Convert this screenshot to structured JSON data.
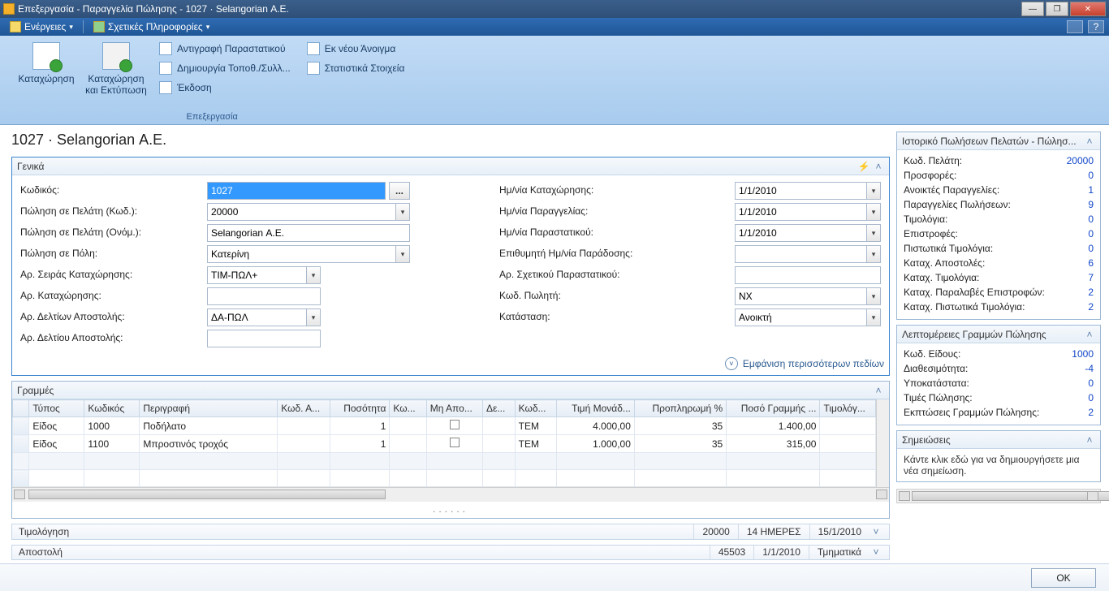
{
  "window": {
    "title": "Επεξεργασία - Παραγγελία Πώλησης - 1027 · Selangorian Α.Ε."
  },
  "menu": {
    "actions": "Ενέργειες",
    "related": "Σχετικές Πληροφορίες"
  },
  "ribbon": {
    "big": [
      {
        "label": "Καταχώρηση"
      },
      {
        "label": "Καταχώρηση και Εκτύπωση"
      }
    ],
    "col1": [
      "Αντιγραφή Παραστατικού",
      "Δημιουργία Τοποθ./Συλλ...",
      "Έκδοση"
    ],
    "col2": [
      "Εκ νέου Άνοιγμα",
      "Στατιστικά Στοιχεία"
    ],
    "group_caption": "Επεξεργασία"
  },
  "page_title": "1027 · Selangorian Α.Ε.",
  "general": {
    "caption": "Γενικά",
    "labels": {
      "code": "Κωδικός:",
      "cust_code": "Πώληση σε Πελάτη (Κωδ.):",
      "cust_name": "Πώληση σε Πελάτη (Ονόμ.):",
      "city": "Πώληση σε Πόλη:",
      "posting_series": "Αρ. Σειράς Καταχώρησης:",
      "posting_no": "Αρ. Καταχώρησης:",
      "ship_series": "Αρ. Δελτίων Αποστολής:",
      "ship_no": "Αρ. Δελτίου Αποστολής:",
      "posting_date": "Ημ/νία Καταχώρησης:",
      "order_date": "Ημ/νία Παραγγελίας:",
      "doc_date": "Ημ/νία Παραστατικού:",
      "req_date": "Επιθυμητή Ημ/νία Παράδοσης:",
      "related_doc": "Αρ. Σχετικού Παραστατικού:",
      "salesperson": "Κωδ. Πωλητή:",
      "status": "Κατάσταση:"
    },
    "values": {
      "code": "1027",
      "cust_code": "20000",
      "cust_name": "Selangorian Α.Ε.",
      "city": "Κατερίνη",
      "posting_series": "ΤΙΜ-ΠΩΛ+",
      "posting_no": "",
      "ship_series": "ΔΑ-ΠΩΛ",
      "ship_no": "",
      "posting_date": "1/1/2010",
      "order_date": "1/1/2010",
      "doc_date": "1/1/2010",
      "req_date": "",
      "related_doc": "",
      "salesperson": "NX",
      "status": "Ανοικτή"
    },
    "show_more": "Εμφάνιση περισσότερων πεδίων"
  },
  "lines": {
    "caption": "Γραμμές",
    "headers": [
      "Τύπος",
      "Κωδικός",
      "Περιγραφή",
      "Κωδ. Α...",
      "Ποσότητα",
      "Κω...",
      "Μη Απο...",
      "Δε...",
      "Κωδ...",
      "Τιμή Μονάδ...",
      "Προπληρωμή %",
      "Ποσό Γραμμής ...",
      "Τιμολόγ..."
    ],
    "rows": [
      {
        "type": "Είδος",
        "code": "1000",
        "desc": "Ποδήλατο",
        "loc": "",
        "qty": "1",
        "uom": "",
        "bin": "",
        "lot": "",
        "unit": "ΤΕΜ",
        "price": "4.000,00",
        "prepay": "35",
        "amount": "1.400,00",
        "inv": ""
      },
      {
        "type": "Είδος",
        "code": "1100",
        "desc": "Μπροστινός τροχός",
        "loc": "",
        "qty": "1",
        "uom": "",
        "bin": "",
        "lot": "",
        "unit": "ΤΕΜ",
        "price": "1.000,00",
        "prepay": "35",
        "amount": "315,00",
        "inv": ""
      }
    ]
  },
  "invoicing": {
    "caption": "Τιμολόγηση",
    "v1": "20000",
    "v2": "14 ΗΜΕΡΕΣ",
    "v3": "15/1/2010"
  },
  "shipping": {
    "caption": "Αποστολή",
    "v1": "45503",
    "v2": "1/1/2010",
    "v3": "Τμηματικά"
  },
  "history": {
    "caption": "Ιστορικό Πωλήσεων Πελατών - Πώλησ...",
    "rows": [
      [
        "Κωδ. Πελάτη:",
        "20000"
      ],
      [
        "Προσφορές:",
        "0"
      ],
      [
        "Ανοικτές Παραγγελίες:",
        "1"
      ],
      [
        "Παραγγελίες Πωλήσεων:",
        "9"
      ],
      [
        "Τιμολόγια:",
        "0"
      ],
      [
        "Επιστροφές:",
        "0"
      ],
      [
        "Πιστωτικά Τιμολόγια:",
        "0"
      ],
      [
        "Καταχ. Αποστολές:",
        "6"
      ],
      [
        "Καταχ. Τιμολόγια:",
        "7"
      ],
      [
        "Καταχ. Παραλαβές Επιστροφών:",
        "2"
      ],
      [
        "Καταχ. Πιστωτικά Τιμολόγια:",
        "2"
      ]
    ]
  },
  "line_details": {
    "caption": "Λεπτομέρειες Γραμμών Πώλησης",
    "rows": [
      [
        "Κωδ. Είδους:",
        "1000"
      ],
      [
        "Διαθεσιμότητα:",
        "-4"
      ],
      [
        "Υποκατάστατα:",
        "0"
      ],
      [
        "Τιμές Πώλησης:",
        "0"
      ],
      [
        "Εκπτώσεις Γραμμών Πώλησης:",
        "2"
      ]
    ]
  },
  "notes": {
    "caption": "Σημειώσεις",
    "placeholder": "Κάντε κλικ εδώ για να δημιουργήσετε μια νέα σημείωση."
  },
  "footer": {
    "ok": "OK"
  }
}
